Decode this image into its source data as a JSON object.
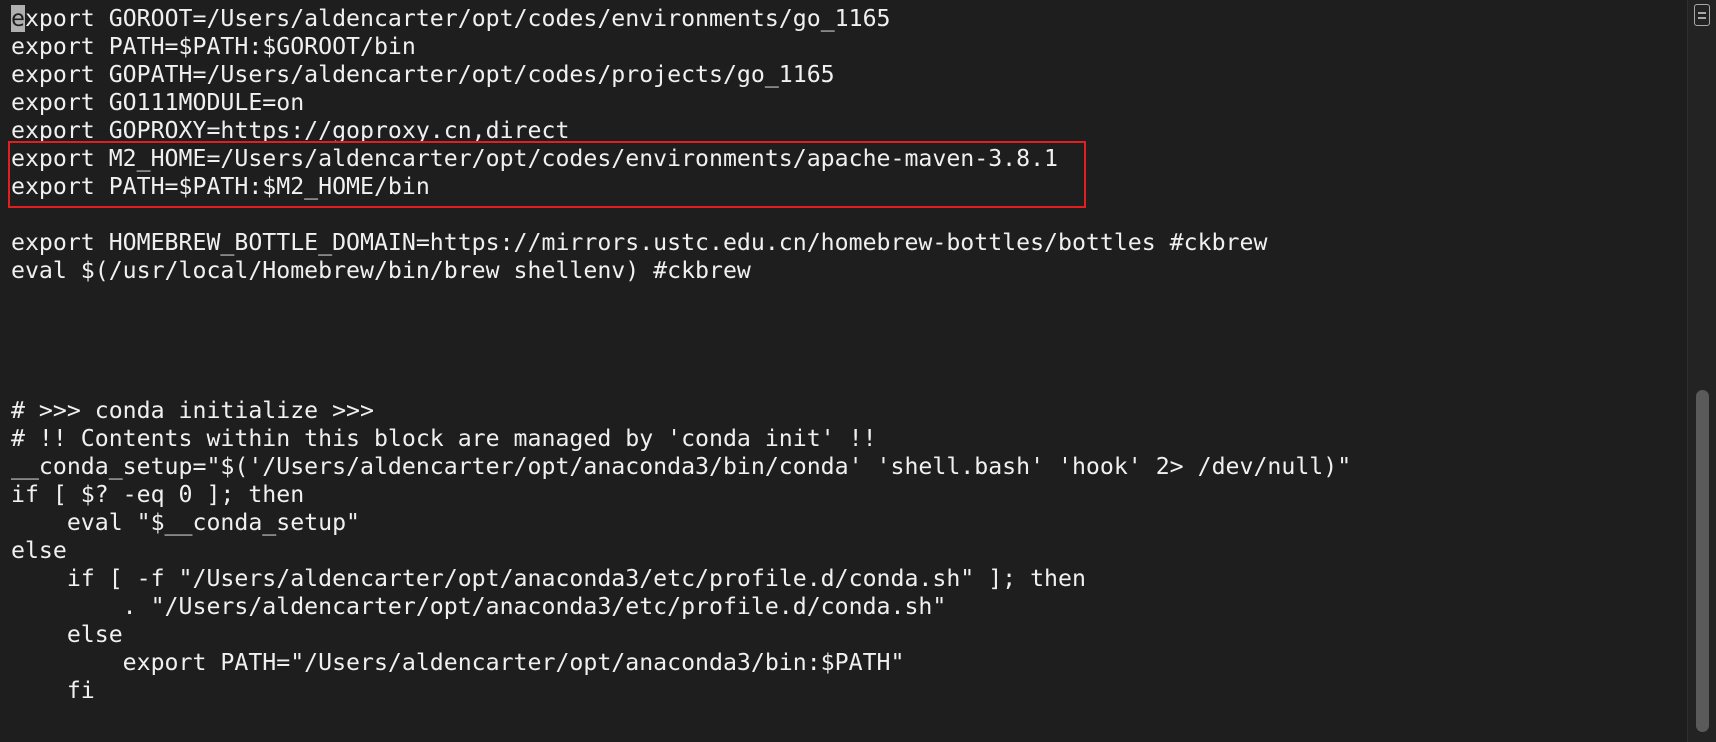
{
  "terminal": {
    "lines": [
      "export GOROOT=/Users/aldencarter/opt/codes/environments/go_1165",
      "export PATH=$PATH:$GOROOT/bin",
      "export GOPATH=/Users/aldencarter/opt/codes/projects/go_1165",
      "export GO111MODULE=on",
      "export GOPROXY=https://goproxy.cn,direct",
      "export M2_HOME=/Users/aldencarter/opt/codes/environments/apache-maven-3.8.1",
      "export PATH=$PATH:$M2_HOME/bin",
      "",
      "export HOMEBREW_BOTTLE_DOMAIN=https://mirrors.ustc.edu.cn/homebrew-bottles/bottles #ckbrew",
      "eval $(/usr/local/Homebrew/bin/brew shellenv) #ckbrew",
      "",
      "",
      "",
      "",
      "# >>> conda initialize >>>",
      "# !! Contents within this block are managed by 'conda init' !!",
      "__conda_setup=\"$('/Users/aldencarter/opt/anaconda3/bin/conda' 'shell.bash' 'hook' 2> /dev/null)\"",
      "if [ $? -eq 0 ]; then",
      "    eval \"$__conda_setup\"",
      "else",
      "    if [ -f \"/Users/aldencarter/opt/anaconda3/etc/profile.d/conda.sh\" ]; then",
      "        . \"/Users/aldencarter/opt/anaconda3/etc/profile.d/conda.sh\"",
      "    else",
      "        export PATH=\"/Users/aldencarter/opt/anaconda3/bin:$PATH\"",
      "    fi"
    ],
    "cursor_char": "e",
    "first_line_rest": "xport GOROOT=/Users/aldencarter/opt/codes/environments/go_1165"
  },
  "colors": {
    "background": "#1e1e1e",
    "text": "#f0f0f0",
    "highlight_border": "#e02020"
  }
}
